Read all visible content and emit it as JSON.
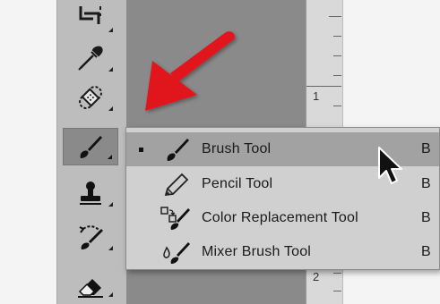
{
  "ruler": {
    "labels": [
      "1",
      "2"
    ]
  },
  "toolbar": {
    "tools": [
      {
        "name": "marquee-tool",
        "icon": "marquee-crop-icon"
      },
      {
        "name": "eyedropper-tool",
        "icon": "eyedropper-icon"
      },
      {
        "name": "healing-brush-tool",
        "icon": "bandage-icon"
      },
      {
        "name": "brush-tool",
        "icon": "brush-icon",
        "active": true
      },
      {
        "name": "clone-stamp-tool",
        "icon": "stamp-icon"
      },
      {
        "name": "history-brush-tool",
        "icon": "history-brush-icon"
      },
      {
        "name": "eraser-tool",
        "icon": "eraser-icon"
      }
    ]
  },
  "flyout": {
    "items": [
      {
        "label": "Brush Tool",
        "shortcut": "B",
        "icon": "brush-icon",
        "selected": true
      },
      {
        "label": "Pencil Tool",
        "shortcut": "B",
        "icon": "pencil-icon",
        "selected": false
      },
      {
        "label": "Color Replacement Tool",
        "shortcut": "B",
        "icon": "color-replacement-icon",
        "selected": false
      },
      {
        "label": "Mixer Brush Tool",
        "shortcut": "B",
        "icon": "mixer-brush-icon",
        "selected": false
      }
    ]
  },
  "annotation": {
    "arrow_color": "#e0161b"
  }
}
